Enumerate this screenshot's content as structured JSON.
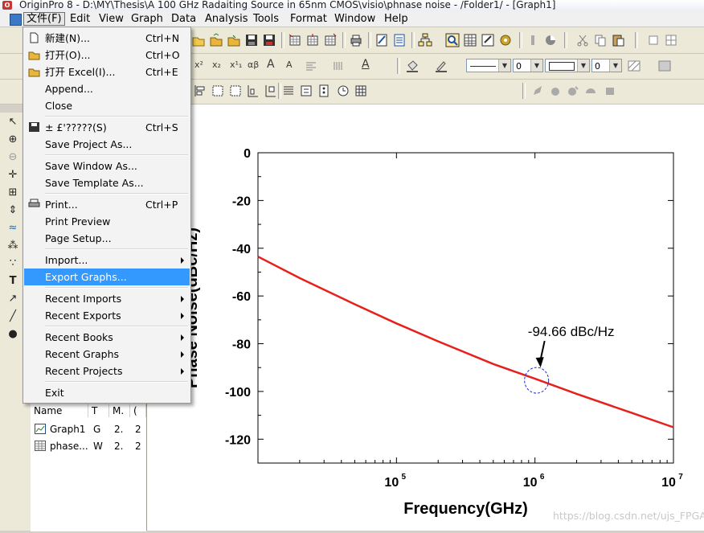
{
  "window": {
    "title": "OriginPro 8 - D:\\MY\\Thesis\\A 100 GHz Radaiting Source in 65nm CMOS\\visio\\phnase noise - /Folder1/ - [Graph1]"
  },
  "menubar": {
    "items": [
      "文件(F)",
      "Edit",
      "View",
      "Graph",
      "Data",
      "Analysis",
      "Tools",
      "Format",
      "Window",
      "Help"
    ]
  },
  "toolbar_format": {
    "size_value": "0",
    "line_width_value": "0",
    "fill_value": "0"
  },
  "file_menu": {
    "items": [
      {
        "label": "新建(N)...",
        "shortcut": "Ctrl+N",
        "icon": "new-doc-icon"
      },
      {
        "label": "打开(O)...",
        "shortcut": "Ctrl+O",
        "icon": "open-folder-icon"
      },
      {
        "label": "打开 Excel(I)...",
        "shortcut": "Ctrl+E",
        "icon": "open-folder-icon"
      },
      {
        "label": "Append..."
      },
      {
        "label": "Close"
      },
      {
        "label": "± £'?????(S)",
        "shortcut": "Ctrl+S",
        "icon": "save-disk-icon"
      },
      {
        "label": "Save Project As..."
      },
      {
        "label": "Save Window As..."
      },
      {
        "label": "Save Template As..."
      },
      {
        "label": "Print...",
        "shortcut": "Ctrl+P",
        "icon": "printer-icon"
      },
      {
        "label": "Print Preview"
      },
      {
        "label": "Page Setup..."
      },
      {
        "label": "Import..."
      },
      {
        "label": "Export Graphs..."
      },
      {
        "label": "Recent Imports"
      },
      {
        "label": "Recent Exports"
      },
      {
        "label": "Recent Books"
      },
      {
        "label": "Recent Graphs"
      },
      {
        "label": "Recent Projects"
      },
      {
        "label": "Exit"
      }
    ],
    "highlighted": "Export Graphs..."
  },
  "explorer": {
    "columns": [
      "Name",
      "T",
      "M.",
      "("
    ],
    "rows": [
      {
        "name": "Graph1",
        "type": "G",
        "modified": "2.",
        "extra": "2"
      },
      {
        "name": "phase...",
        "type": "W",
        "modified": "2.",
        "extra": "2"
      }
    ]
  },
  "chart_data": {
    "type": "line",
    "xlabel": "Frequency(GHz)",
    "ylabel": "Phase Noise(dBc/Hz)",
    "x_scale": "log",
    "xlim": [
      10000,
      10000000
    ],
    "ylim": [
      -130,
      0
    ],
    "yticks": [
      0,
      -20,
      -40,
      -60,
      -80,
      -100,
      -120
    ],
    "xtick_labels": [
      {
        "base": "10",
        "exp": "5",
        "value": 100000
      },
      {
        "base": "10",
        "exp": "6",
        "value": 1000000
      },
      {
        "base": "10",
        "exp": "7",
        "value": 10000000
      }
    ],
    "series": [
      {
        "color": "#e8201c",
        "x": [
          10000,
          20000,
          50000,
          100000,
          200000,
          500000,
          1000000,
          2000000,
          5000000,
          10000000
        ],
        "y": [
          -43.5,
          -52.5,
          -63.5,
          -71.5,
          -79.0,
          -88.5,
          -94.66,
          -101.0,
          -109.0,
          -115.0
        ]
      }
    ],
    "annotation": {
      "text": "-94.66 dBc/Hz",
      "x": 1000000,
      "y": -94.66
    }
  },
  "watermark": "https://blog.csdn.net/ujs_FPGA"
}
